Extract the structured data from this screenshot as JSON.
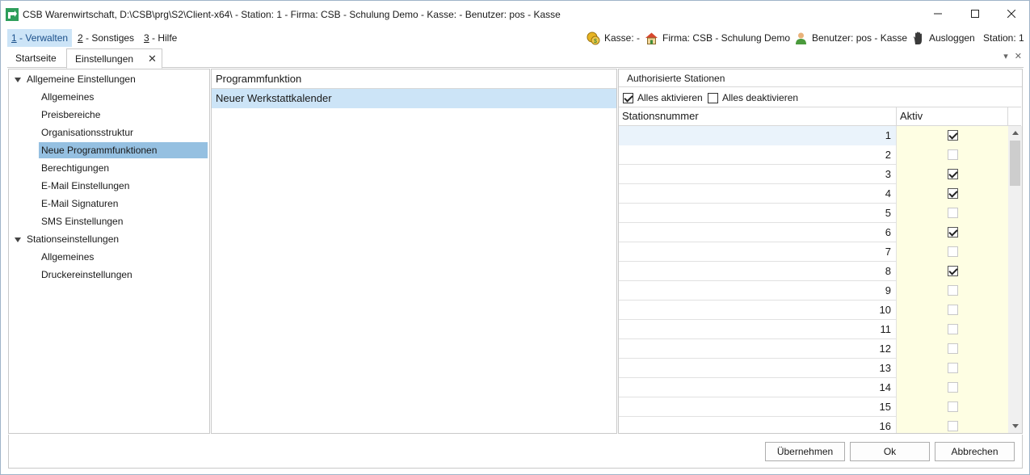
{
  "window": {
    "title": "CSB Warenwirtschaft, D:\\CSB\\prg\\S2\\Client-x64\\ - Station: 1 - Firma: CSB - Schulung Demo - Kasse:  - Benutzer: pos - Kasse"
  },
  "menu": {
    "items": [
      {
        "key": "1",
        "label": " - Verwalten"
      },
      {
        "key": "2",
        "label": " - Sonstiges"
      },
      {
        "key": "3",
        "label": " - Hilfe"
      }
    ]
  },
  "status": {
    "kasse": "Kasse: -",
    "firma": "Firma: CSB - Schulung Demo",
    "benutzer": "Benutzer: pos - Kasse",
    "ausloggen": "Ausloggen",
    "station": "Station: 1"
  },
  "tabs": [
    {
      "label": "Startseite"
    },
    {
      "label": "Einstellungen"
    }
  ],
  "tree": {
    "groups": [
      {
        "label": "Allgemeine Einstellungen",
        "children": [
          "Allgemeines",
          "Preisbereiche",
          "Organisationsstruktur",
          "Neue Programmfunktionen",
          "Berechtigungen",
          "E-Mail Einstellungen",
          "E-Mail Signaturen",
          "SMS Einstellungen"
        ]
      },
      {
        "label": "Stationseinstellungen",
        "children": [
          "Allgemeines",
          "Druckereinstellungen"
        ]
      }
    ],
    "selected": "Neue Programmfunktionen"
  },
  "program": {
    "header": "Programmfunktion",
    "rows": [
      "Neuer Werkstattkalender"
    ]
  },
  "auth": {
    "title": "Authorisierte Stationen",
    "activate_all": "Alles aktivieren",
    "deactivate_all": "Alles deaktivieren",
    "col_station": "Stationsnummer",
    "col_active": "Aktiv",
    "rows": [
      {
        "nr": "1",
        "active": true
      },
      {
        "nr": "2",
        "active": false
      },
      {
        "nr": "3",
        "active": true
      },
      {
        "nr": "4",
        "active": true
      },
      {
        "nr": "5",
        "active": false
      },
      {
        "nr": "6",
        "active": true
      },
      {
        "nr": "7",
        "active": false
      },
      {
        "nr": "8",
        "active": true
      },
      {
        "nr": "9",
        "active": false
      },
      {
        "nr": "10",
        "active": false
      },
      {
        "nr": "11",
        "active": false
      },
      {
        "nr": "12",
        "active": false
      },
      {
        "nr": "13",
        "active": false
      },
      {
        "nr": "14",
        "active": false
      },
      {
        "nr": "15",
        "active": false
      },
      {
        "nr": "16",
        "active": false
      }
    ]
  },
  "buttons": {
    "apply": "Übernehmen",
    "ok": "Ok",
    "cancel": "Abbrechen"
  },
  "colors": {
    "selection": "#95c0e1",
    "menu_active": "#cce4f7",
    "active_column": "#fefee3"
  },
  "icons": [
    "app-logo-icon",
    "coins-icon",
    "house-icon",
    "user-icon",
    "hand-icon"
  ]
}
